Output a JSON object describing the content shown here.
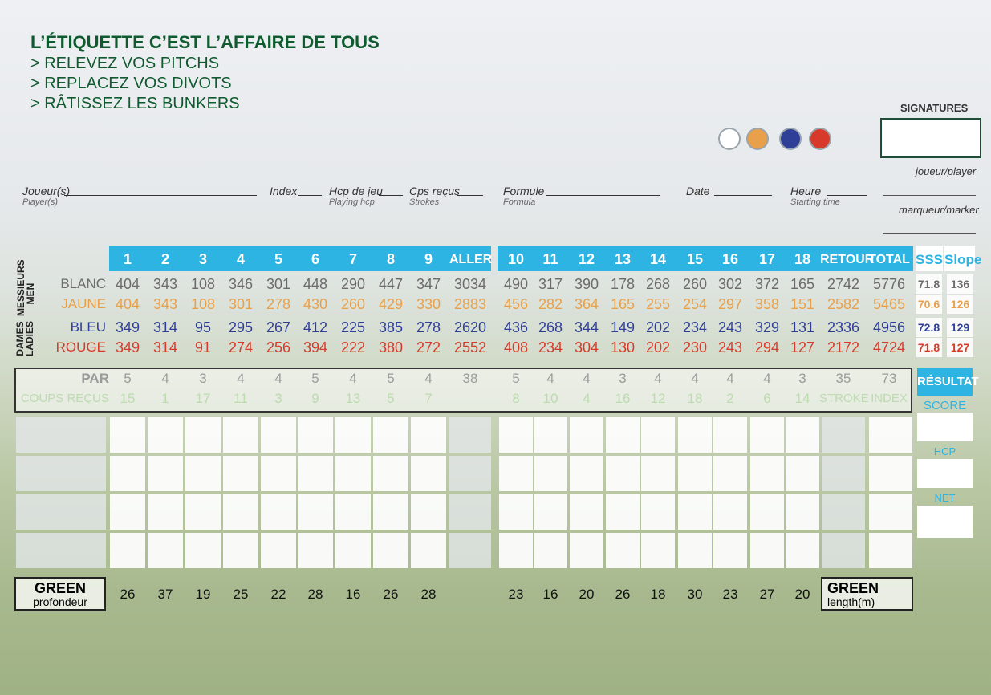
{
  "header": {
    "title": "L’ÉTIQUETTE C’EST L’AFFAIRE DE TOUS",
    "tips": [
      "> RELEVEZ VOS PITCHS",
      "> REPLACEZ VOS DIVOTS",
      "> RÂTISSEZ LES BUNKERS"
    ]
  },
  "signatures": {
    "label": "SIGNATURES",
    "player": "joueur/player",
    "marker": "marqueur/marker"
  },
  "tee_colors": [
    "#ffffff",
    "#e9a04a",
    "#2f3f98",
    "#d73a2a"
  ],
  "fields": [
    {
      "label": "Joueur(s)",
      "sub": "Player(s)"
    },
    {
      "label": "Index",
      "sub": ""
    },
    {
      "label": "Hcp de jeu",
      "sub": "Playing hcp"
    },
    {
      "label": "Cps reçus",
      "sub": "Strokes"
    },
    {
      "label": "Formule",
      "sub": "Formula"
    },
    {
      "label": "Date",
      "sub": ""
    },
    {
      "label": "Heure",
      "sub": "Starting time"
    }
  ],
  "holes_out": [
    "1",
    "2",
    "3",
    "4",
    "5",
    "6",
    "7",
    "8",
    "9"
  ],
  "holes_in": [
    "10",
    "11",
    "12",
    "13",
    "14",
    "15",
    "16",
    "17",
    "18"
  ],
  "labels": {
    "aller": "ALLER",
    "retour": "RETOUR",
    "total": "TOTAL",
    "sss": "SSS",
    "slope": "Slope",
    "men": [
      "MESSIEURS",
      "MEN"
    ],
    "ladies": [
      "DAMES",
      "LADIES"
    ]
  },
  "tees": [
    {
      "name": "BLANC",
      "color": "#6b6b6b",
      "out": [
        "404",
        "343",
        "108",
        "346",
        "301",
        "448",
        "290",
        "447",
        "347"
      ],
      "aller": "3034",
      "in": [
        "490",
        "317",
        "390",
        "178",
        "268",
        "260",
        "302",
        "372",
        "165"
      ],
      "retour": "2742",
      "total": "5776",
      "sss": "71.8",
      "slope": "136"
    },
    {
      "name": "JAUNE",
      "color": "#e9a04a",
      "out": [
        "404",
        "343",
        "108",
        "301",
        "278",
        "430",
        "260",
        "429",
        "330"
      ],
      "aller": "2883",
      "in": [
        "456",
        "282",
        "364",
        "165",
        "255",
        "254",
        "297",
        "358",
        "151"
      ],
      "retour": "2582",
      "total": "5465",
      "sss": "70.6",
      "slope": "126"
    },
    {
      "name": "BLEU",
      "color": "#2f3f98",
      "out": [
        "349",
        "314",
        "95",
        "295",
        "267",
        "412",
        "225",
        "385",
        "278"
      ],
      "aller": "2620",
      "in": [
        "436",
        "268",
        "344",
        "149",
        "202",
        "234",
        "243",
        "329",
        "131"
      ],
      "retour": "2336",
      "total": "4956",
      "sss": "72.8",
      "slope": "129"
    },
    {
      "name": "ROUGE",
      "color": "#d73a2a",
      "out": [
        "349",
        "314",
        "91",
        "274",
        "256",
        "394",
        "222",
        "380",
        "272"
      ],
      "aller": "2552",
      "in": [
        "408",
        "234",
        "304",
        "130",
        "202",
        "230",
        "243",
        "294",
        "127"
      ],
      "retour": "2172",
      "total": "4724",
      "sss": "71.8",
      "slope": "127"
    }
  ],
  "par": {
    "label": "PAR",
    "out": [
      "5",
      "4",
      "3",
      "4",
      "4",
      "5",
      "4",
      "5",
      "4"
    ],
    "aller": "38",
    "in": [
      "5",
      "4",
      "4",
      "3",
      "4",
      "4",
      "4",
      "4",
      "3"
    ],
    "retour": "35",
    "total": "73"
  },
  "coups": {
    "label": "COUPS REÇUS",
    "out": [
      "15",
      "1",
      "17",
      "11",
      "3",
      "9",
      "13",
      "5",
      "7"
    ],
    "in": [
      "8",
      "10",
      "4",
      "16",
      "12",
      "18",
      "2",
      "6",
      "14"
    ],
    "stroke": "STROKE",
    "index": "INDEX"
  },
  "result": {
    "title": "RÉSULTAT",
    "score": "SCORE",
    "hcp": "HCP",
    "net": "NET"
  },
  "green": {
    "label1": "GREEN",
    "sub1": "profondeur",
    "label2": "GREEN",
    "sub2": "length(m)",
    "out": [
      "26",
      "37",
      "19",
      "25",
      "22",
      "28",
      "16",
      "26",
      "28"
    ],
    "in": [
      "23",
      "16",
      "20",
      "26",
      "18",
      "30",
      "23",
      "27",
      "20"
    ]
  }
}
